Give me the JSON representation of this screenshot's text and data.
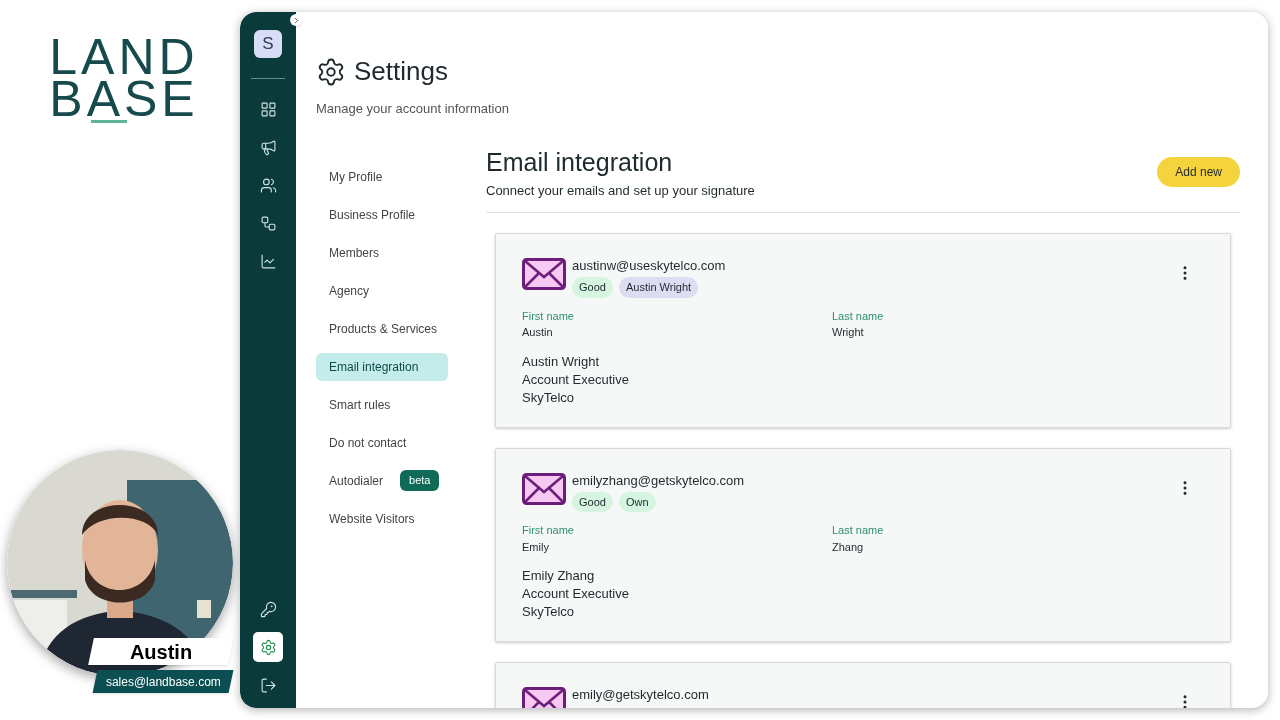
{
  "brand": {
    "line_1": "LAND",
    "line_2": "BASE"
  },
  "presenter": {
    "name": "Austin",
    "email": "sales@landbase.com"
  },
  "sidebar": {
    "avatar": "S",
    "icons": [
      {
        "kind": "dashboard",
        "selected": false
      },
      {
        "kind": "campaigns",
        "selected": false
      },
      {
        "kind": "contacts",
        "selected": false
      },
      {
        "kind": "workflows",
        "selected": false
      },
      {
        "kind": "analytics",
        "selected": false
      }
    ],
    "bottom_icons": [
      {
        "kind": "keys",
        "selected": false
      },
      {
        "kind": "settings",
        "selected": true
      },
      {
        "kind": "logout",
        "selected": false
      }
    ]
  },
  "page": {
    "title": "Settings",
    "subtitle": "Manage your account information"
  },
  "menu": [
    {
      "label": "My Profile",
      "selected": false
    },
    {
      "label": "Business Profile",
      "selected": false
    },
    {
      "label": "Members",
      "selected": false
    },
    {
      "label": "Agency",
      "selected": false
    },
    {
      "label": "Products & Services",
      "selected": false
    },
    {
      "label": "Email integration",
      "selected": true
    },
    {
      "label": "Smart rules",
      "selected": false
    },
    {
      "label": "Do not contact",
      "selected": false
    },
    {
      "label": "Autodialer",
      "selected": false,
      "badge": "beta"
    },
    {
      "label": "Website Visitors",
      "selected": false
    }
  ],
  "section": {
    "title": "Email integration",
    "subtitle": "Connect your emails and set up your signature",
    "add_button": "Add new"
  },
  "accounts": [
    {
      "email": "austinw@useskytelco.com",
      "tags": [
        {
          "label": "Good",
          "color": "#d5f5e0"
        },
        {
          "label": "Austin Wright",
          "color": "#dcdcf3"
        }
      ],
      "first_name_label": "First name",
      "first_name": "Austin",
      "last_name_label": "Last name",
      "last_name": "Wright",
      "signature": [
        "Austin Wright",
        "Account Executive",
        "SkyTelco"
      ]
    },
    {
      "email": "emilyzhang@getskytelco.com",
      "tags": [
        {
          "label": "Good",
          "color": "#d5f5e0"
        },
        {
          "label": "Own",
          "color": "#d5f5e0"
        }
      ],
      "first_name_label": "First name",
      "first_name": "Emily",
      "last_name_label": "Last name",
      "last_name": "Zhang",
      "signature": [
        "Emily Zhang",
        "Account Executive",
        "SkyTelco"
      ]
    },
    {
      "email": "emily@getskytelco.com"
    }
  ]
}
